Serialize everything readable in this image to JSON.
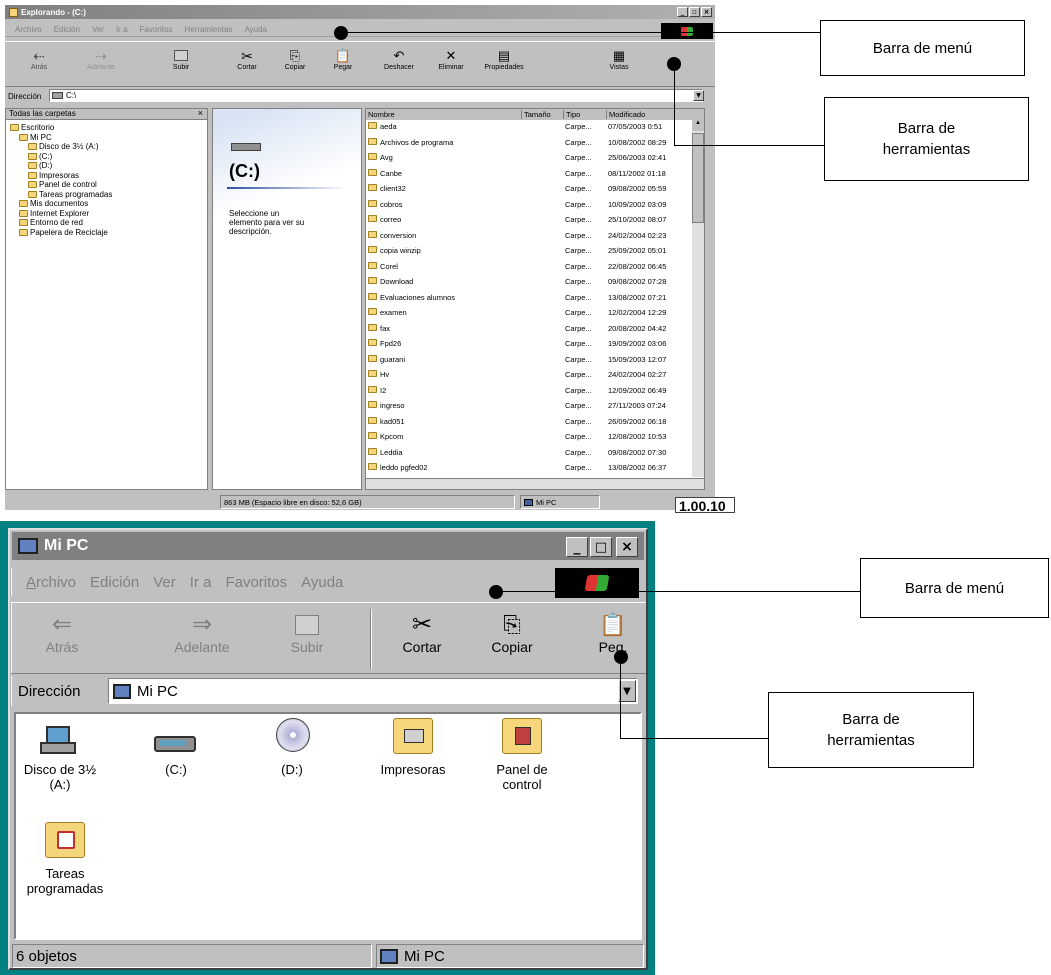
{
  "top": {
    "title": "Explorando - (C:)",
    "menu": [
      "Archivo",
      "Edición",
      "Ver",
      "Ir a",
      "Favoritos",
      "Herramientas",
      "Ayuda"
    ],
    "tools": [
      "Atrás",
      "Adelante",
      "Subir",
      "Cortar",
      "Copiar",
      "Pegar",
      "Deshacer",
      "Eliminar",
      "Propiedades",
      "Vistas"
    ],
    "address_label": "Dirección",
    "address_value": "C:\\",
    "tree_header": "Todas las carpetas",
    "tree": [
      {
        "label": "Escritorio",
        "level": 0
      },
      {
        "label": "Mi PC",
        "level": 1
      },
      {
        "label": "Disco de 3½ (A:)",
        "level": 2
      },
      {
        "label": "(C:)",
        "level": 2
      },
      {
        "label": "(D:)",
        "level": 2
      },
      {
        "label": "Impresoras",
        "level": 2
      },
      {
        "label": "Panel de control",
        "level": 2
      },
      {
        "label": "Tareas programadas",
        "level": 2
      },
      {
        "label": "Mis documentos",
        "level": 1
      },
      {
        "label": "Internet Explorer",
        "level": 1
      },
      {
        "label": "Entorno de red",
        "level": 1
      },
      {
        "label": "Papelera de Reciclaje",
        "level": 1
      }
    ],
    "drive_title": "(C:)",
    "drive_desc": "Seleccione un elemento para ver su descripción.",
    "columns": [
      "Nombre",
      "Tamaño",
      "Tipo",
      "Modificado"
    ],
    "files": [
      {
        "name": "aeda",
        "type": "Carpe...",
        "date": "07/05/2003 0:51"
      },
      {
        "name": "Archivos de programa",
        "type": "Carpe...",
        "date": "10/08/2002 08:29"
      },
      {
        "name": "Avg",
        "type": "Carpe...",
        "date": "25/06/2003 02:41"
      },
      {
        "name": "Canbe",
        "type": "Carpe...",
        "date": "08/11/2002 01:18"
      },
      {
        "name": "client32",
        "type": "Carpe...",
        "date": "09/08/2002 05:59"
      },
      {
        "name": "cobros",
        "type": "Carpe...",
        "date": "10/09/2002 03:09"
      },
      {
        "name": "correo",
        "type": "Carpe...",
        "date": "25/10/2002 08:07"
      },
      {
        "name": "conversion",
        "type": "Carpe...",
        "date": "24/02/2004 02:23"
      },
      {
        "name": "copia winzip",
        "type": "Carpe...",
        "date": "25/09/2002 05:01"
      },
      {
        "name": "Corel",
        "type": "Carpe...",
        "date": "22/08/2002 06:45"
      },
      {
        "name": "Download",
        "type": "Carpe...",
        "date": "09/08/2002 07:28"
      },
      {
        "name": "Evaluaciones alumnos",
        "type": "Carpe...",
        "date": "13/08/2002 07:21"
      },
      {
        "name": "examen",
        "type": "Carpe...",
        "date": "12/02/2004 12:29"
      },
      {
        "name": "fax",
        "type": "Carpe...",
        "date": "20/08/2002 04:42"
      },
      {
        "name": "Fpd26",
        "type": "Carpe...",
        "date": "19/09/2002 03:06"
      },
      {
        "name": "guarani",
        "type": "Carpe...",
        "date": "15/09/2003 12:07"
      },
      {
        "name": "Hv",
        "type": "Carpe...",
        "date": "24/02/2004 02:27"
      },
      {
        "name": "I2",
        "type": "Carpe...",
        "date": "12/09/2002 06:49"
      },
      {
        "name": "ingreso",
        "type": "Carpe...",
        "date": "27/11/2003 07:24"
      },
      {
        "name": "kad051",
        "type": "Carpe...",
        "date": "26/09/2002 06:18"
      },
      {
        "name": "Kpcom",
        "type": "Carpe...",
        "date": "12/08/2002 10:53"
      },
      {
        "name": "Leddia",
        "type": "Carpe...",
        "date": "09/08/2002 07:30"
      },
      {
        "name": "leddo pgfed02",
        "type": "Carpe...",
        "date": "13/08/2002 06:37"
      }
    ],
    "status_left": "863 MB (Espacio libre en disco: 52,6 GB)",
    "status_right": "Mi PC",
    "tag": "1.00.10",
    "callout_menu": "Barra de menú",
    "callout_tools": "Barra de herramientas"
  },
  "bottom": {
    "title": "Mi PC",
    "menu": [
      "Archivo",
      "Edición",
      "Ver",
      "Ir a",
      "Favoritos",
      "Ayuda"
    ],
    "tools": [
      "Atrás",
      "Adelante",
      "Subir",
      "Cortar",
      "Copiar",
      "Peg."
    ],
    "address_label": "Dirección",
    "address_value": "Mi PC",
    "items": [
      "Disco de 3½ (A:)",
      "(C:)",
      "(D:)",
      "Impresoras",
      "Panel de control",
      "Tareas programadas"
    ],
    "status_left": "6 objetos",
    "status_right": "Mi PC",
    "callout_menu": "Barra de menú",
    "callout_tools": "Barra de herramientas"
  },
  "colors": {
    "title_top": "#808080",
    "title_bottom": "#808080",
    "frame_bottom": "#008080"
  }
}
